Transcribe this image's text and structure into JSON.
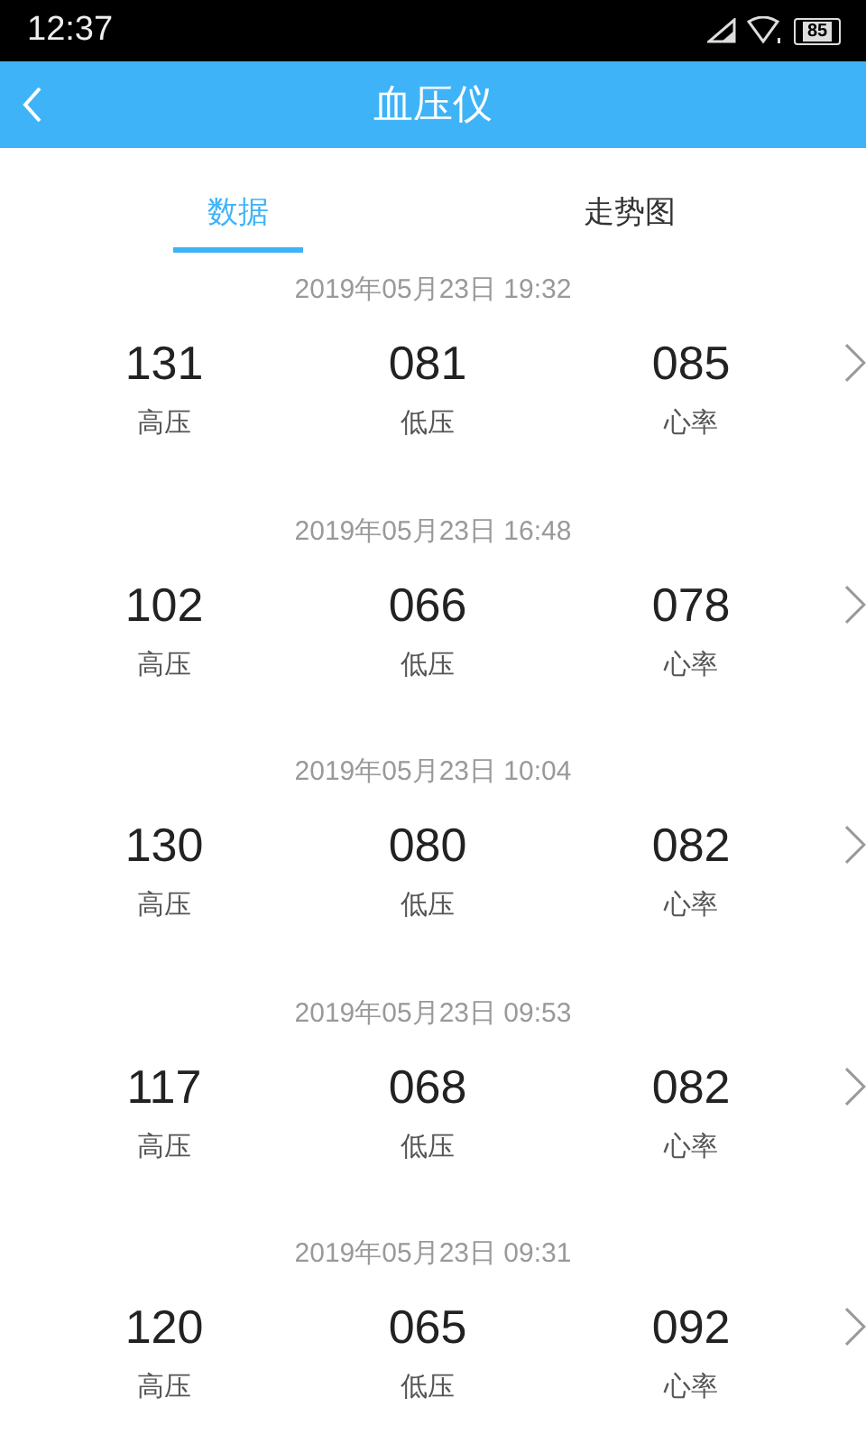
{
  "status_bar": {
    "time": "12:37",
    "battery": "85"
  },
  "header": {
    "title": "血压仪"
  },
  "tabs": [
    {
      "label": "数据",
      "selected": true
    },
    {
      "label": "走势图",
      "selected": false
    }
  ],
  "records": [
    {
      "datetime": "2019年05月23日 19:32",
      "systolic": "131",
      "systolic_label": "高压",
      "diastolic": "081",
      "diastolic_label": "低压",
      "pulse": "085",
      "pulse_label": "心率"
    },
    {
      "datetime": "2019年05月23日 16:48",
      "systolic": "102",
      "systolic_label": "高压",
      "diastolic": "066",
      "diastolic_label": "低压",
      "pulse": "078",
      "pulse_label": "心率"
    },
    {
      "datetime": "2019年05月23日 10:04",
      "systolic": "130",
      "systolic_label": "高压",
      "diastolic": "080",
      "diastolic_label": "低压",
      "pulse": "082",
      "pulse_label": "心率"
    },
    {
      "datetime": "2019年05月23日 09:53",
      "systolic": "117",
      "systolic_label": "高压",
      "diastolic": "068",
      "diastolic_label": "低压",
      "pulse": "082",
      "pulse_label": "心率"
    },
    {
      "datetime": "2019年05月23日 09:31",
      "systolic": "120",
      "systolic_label": "高压",
      "diastolic": "065",
      "diastolic_label": "低压",
      "pulse": "092",
      "pulse_label": "心率"
    }
  ]
}
